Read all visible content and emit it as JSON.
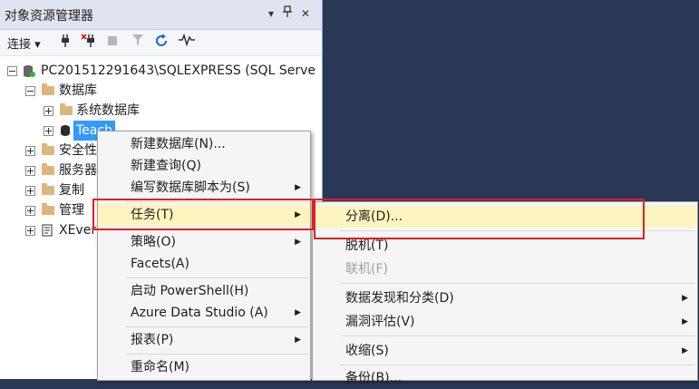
{
  "panel": {
    "title": "对象资源管理器",
    "title_buttons": [
      "▾",
      "📌",
      "✕"
    ],
    "toolbar": {
      "connect_label": "连接",
      "connect_arrow": "▾"
    }
  },
  "tree": {
    "server": "PC201512291643\\SQLEXPRESS (SQL Serve",
    "databases": "数据库",
    "system_db": "系统数据库",
    "teach": "Teach",
    "security": "安全性",
    "server_objects": "服务器",
    "replication": "复制",
    "management": "管理",
    "xevent": "XEver"
  },
  "context_menu": {
    "items": [
      {
        "label": "新建数据库(N)...",
        "arrow": ""
      },
      {
        "label": "新建查询(Q)",
        "arrow": ""
      },
      {
        "label": "编写数据库脚本为(S)",
        "arrow": "▶"
      },
      {
        "label": "任务(T)",
        "arrow": "▶"
      },
      {
        "label": "策略(O)",
        "arrow": "▶"
      },
      {
        "label": "Facets(A)",
        "arrow": ""
      },
      {
        "label": "启动 PowerShell(H)",
        "arrow": ""
      },
      {
        "label": "Azure Data Studio (A)",
        "arrow": "▶"
      },
      {
        "label": "报表(P)",
        "arrow": "▶"
      },
      {
        "label": "重命名(M)",
        "arrow": ""
      }
    ]
  },
  "tasks_submenu": {
    "items": [
      {
        "label": "分离(D)...",
        "arrow": ""
      },
      {
        "label": "脱机(T)",
        "arrow": ""
      },
      {
        "label": "联机(F)",
        "arrow": ""
      },
      {
        "label": "数据发现和分类(D)",
        "arrow": "▶"
      },
      {
        "label": "漏洞评估(V)",
        "arrow": "▶"
      },
      {
        "label": "收缩(S)",
        "arrow": "▶"
      },
      {
        "label": "备份(B)...",
        "arrow": ""
      }
    ]
  },
  "colors": {
    "highlight": "#fdf4bf",
    "annotation": "#e02020",
    "selection": "#3399ff"
  }
}
